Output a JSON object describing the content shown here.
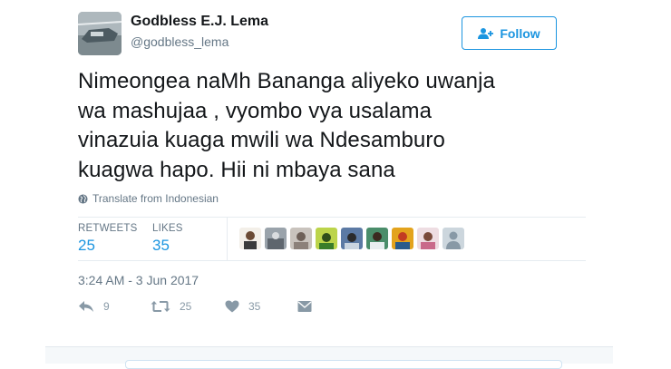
{
  "user": {
    "name": "Godbless E.J. Lema",
    "handle": "@godbless_lema"
  },
  "follow_button": {
    "label": "Follow"
  },
  "tweet": {
    "text": "Nimeongea naMh Bananga aliyeko uwanja\nwa mashujaa ,  vyombo vya usalama\nvinazuia kuaga mwili wa Ndesamburo\nkuagwa hapo. Hii ni mbaya sana",
    "translate_label": "Translate from Indonesian"
  },
  "stats": {
    "retweets_label": "RETWEETS",
    "retweets_value": "25",
    "likes_label": "LIKES",
    "likes_value": "35"
  },
  "likers": [
    {
      "icon": "avatar",
      "color": "#c9a878"
    },
    {
      "icon": "avatar",
      "color": "#9aa3ab"
    },
    {
      "icon": "avatar",
      "color": "#b8b0aa"
    },
    {
      "icon": "avatar",
      "color": "#bcd44a"
    },
    {
      "icon": "avatar",
      "color": "#5c7aa4"
    },
    {
      "icon": "avatar",
      "color": "#4a8d6a"
    },
    {
      "icon": "avatar",
      "color": "#e3a31d"
    },
    {
      "icon": "avatar",
      "color": "#d8aeb8"
    },
    {
      "icon": "default-avatar",
      "color": "#ccd6dd"
    }
  ],
  "timestamp": "3:24 AM - 3 Jun 2017",
  "actions": {
    "reply_count": "9",
    "retweet_count": "25",
    "like_count": "35"
  },
  "colors": {
    "accent": "#1b95e0",
    "muted": "#657786",
    "icon_gray": "#8899a6"
  }
}
